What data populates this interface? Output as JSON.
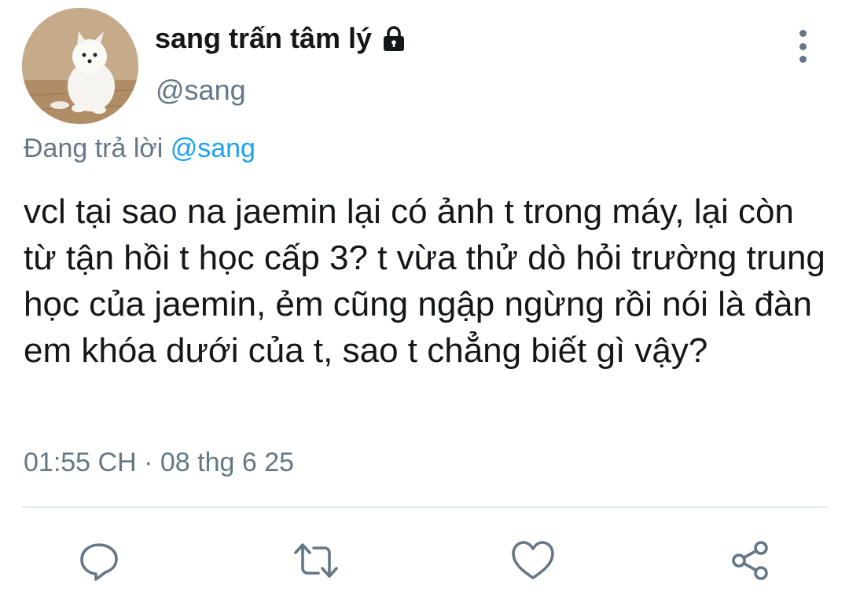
{
  "header": {
    "display_name": "sang trấn tâm lý",
    "handle": "@sang"
  },
  "reply": {
    "prefix": "Đang trả lời",
    "mention": "@sang"
  },
  "tweet": {
    "text": "vcl tại sao na jaemin lại có ảnh t trong máy, lại còn từ tận hồi t học cấp 3? t vừa thử dò hỏi trường trung học của jaemin, ẻm cũng ngập ngừng rồi nói là đàn em khóa dưới của t, sao t chẳng biết gì vậy?",
    "time": "01:55 CH",
    "separator": "·",
    "date": "08 thg 6 25"
  },
  "icons": {
    "avatar": "puppy-photo",
    "lock": "lock-icon",
    "more": "more-vertical-icon",
    "reply": "reply-icon",
    "retweet": "retweet-icon",
    "like": "like-icon",
    "share": "share-icon"
  },
  "colors": {
    "text": "#14171a",
    "secondary": "#657786",
    "accent": "#1da1f2",
    "divider": "#e1e8ed"
  }
}
